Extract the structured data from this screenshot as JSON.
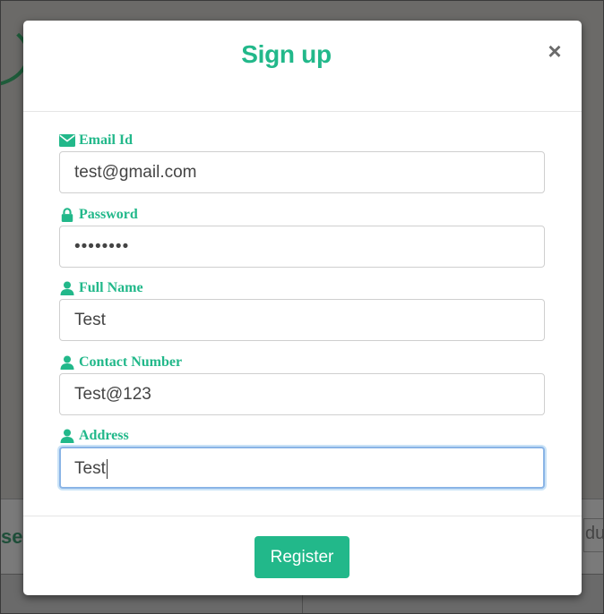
{
  "modal": {
    "title": "Sign up",
    "close_label": "×"
  },
  "form": {
    "fields": [
      {
        "label": "Email Id",
        "icon": "envelope-icon",
        "value": "test@gmail.com"
      },
      {
        "label": "Password",
        "icon": "lock-icon",
        "value": "••••••••"
      },
      {
        "label": "Full Name",
        "icon": "user-icon",
        "value": "Test"
      },
      {
        "label": "Contact Number",
        "icon": "user-icon",
        "value": "Test@123"
      },
      {
        "label": "Address",
        "icon": "user-icon",
        "value": "Test"
      }
    ]
  },
  "footer": {
    "register_label": "Register"
  },
  "background": {
    "left_text": "se",
    "right_text": "du"
  },
  "colors": {
    "accent": "#22b88a",
    "focus_border": "#8ab4e6"
  }
}
